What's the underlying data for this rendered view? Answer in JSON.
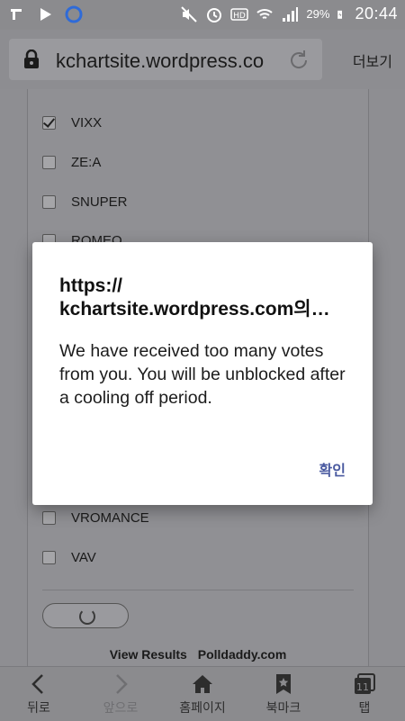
{
  "status_bar": {
    "battery": "29%",
    "time": "20:44"
  },
  "address_bar": {
    "url": "kchartsite.wordpress.co",
    "more_label": "더보기"
  },
  "poll": {
    "items": [
      {
        "label": "VIXX",
        "checked": true
      },
      {
        "label": "ZE:A",
        "checked": false
      },
      {
        "label": "SNUPER",
        "checked": false
      },
      {
        "label": "ROMEO",
        "checked": false
      },
      {
        "label": "VROMANCE",
        "checked": false
      },
      {
        "label": "VAV",
        "checked": false
      }
    ],
    "footer_view_results": "View Results",
    "footer_polldaddy": "Polldaddy.com"
  },
  "dialog": {
    "title_line1": "https://",
    "title_line2": "kchartsite.wordpress.com의…",
    "message": "We have received too many votes from you. You will be unblocked after a cooling off period.",
    "ok_label": "확인"
  },
  "bottom_nav": {
    "back": "뒤로",
    "forward": "앞으로",
    "home": "홈페이지",
    "bookmarks": "북마크",
    "tabs": "탭",
    "tab_count": "11"
  }
}
